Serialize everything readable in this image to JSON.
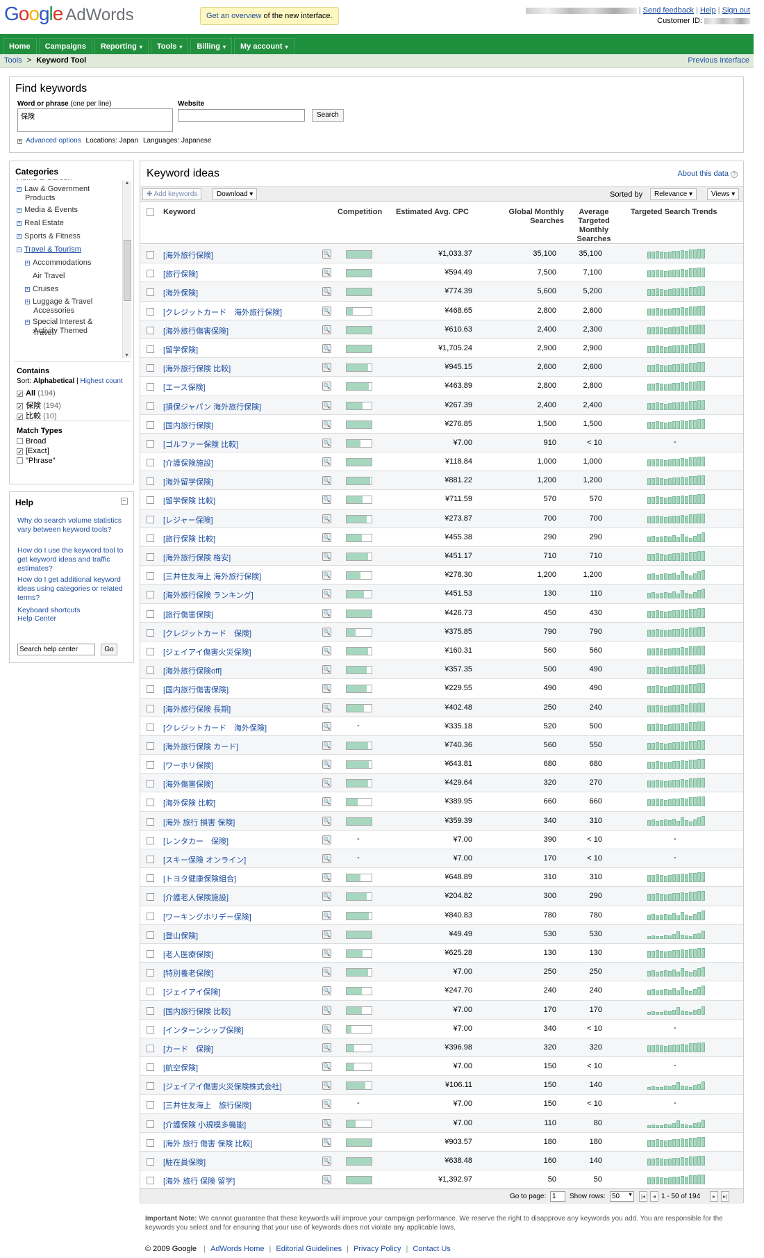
{
  "header": {
    "logo_google": "Google",
    "logo_product": "AdWords",
    "promo_link": "Get an overview",
    "promo_rest": " of the new interface.",
    "send_feedback": "Send feedback",
    "help": "Help",
    "sign_out": "Sign out",
    "customer_id_label": "Customer ID:"
  },
  "nav": {
    "tabs": [
      {
        "label": "Home",
        "caret": ""
      },
      {
        "label": "Campaigns",
        "caret": ""
      },
      {
        "label": "Reporting",
        "caret": "▾"
      },
      {
        "label": "Tools",
        "caret": "▾"
      },
      {
        "label": "Billing",
        "caret": "▾"
      },
      {
        "label": "My account",
        "caret": "▾"
      }
    ]
  },
  "breadcrumb": {
    "parent": "Tools",
    "sep": ">",
    "current": "Keyword Tool",
    "prev_interface": "Previous Interface"
  },
  "find": {
    "title": "Find keywords",
    "word_label": "Word or phrase",
    "word_hint": "(one per line)",
    "word_value": "保険",
    "website_label": "Website",
    "website_value": "",
    "search_button": "Search",
    "advanced": "Advanced options",
    "locations": "Locations: Japan",
    "languages": "Languages: Japanese"
  },
  "categories": {
    "title": "Categories",
    "cut_item": "Home & Garden",
    "items": [
      {
        "label": "Law & Government",
        "label2": "Products",
        "level": 0
      },
      {
        "label": "Media & Events",
        "label2": "",
        "level": 0
      },
      {
        "label": "Real Estate",
        "label2": "",
        "level": 0
      },
      {
        "label": "Sports & Fitness",
        "label2": "",
        "level": 0
      },
      {
        "label": "Travel & Tourism",
        "label2": "",
        "level": 0
      },
      {
        "label": "Accommodations",
        "label2": "",
        "level": 1
      },
      {
        "label": "Air Travel",
        "label2": "",
        "level": 1
      },
      {
        "label": "Cruises",
        "label2": "",
        "level": 1
      },
      {
        "label": "Luggage & Travel",
        "label2": "Accessories",
        "level": 1
      },
      {
        "label": "Special Interest &",
        "label2": "Activity Themed",
        "level": 1
      },
      {
        "label": "Travel",
        "label2": "",
        "level": 1
      }
    ],
    "contains_title": "Contains",
    "sort_label": "Sort:",
    "sort_alpha": "Alphabetical",
    "sort_sep": "|",
    "sort_count": "Highest count",
    "contains": [
      {
        "label": "All",
        "count": "(194)",
        "checked": "✓"
      },
      {
        "label": "保険",
        "count": "(194)",
        "checked": "✓"
      },
      {
        "label": "比較",
        "count": "(10)",
        "checked": "✓"
      }
    ],
    "match_title": "Match Types",
    "match": [
      {
        "label": "Broad",
        "checked": ""
      },
      {
        "label": "[Exact]",
        "checked": "✓"
      },
      {
        "label": "\"Phrase\"",
        "checked": ""
      }
    ]
  },
  "help": {
    "title": "Help",
    "links": [
      "Why do search volume statistics vary between keyword tools?",
      "How do I use the keyword tool to get keyword ideas and traffic estimates?",
      "How do I get additional keyword ideas using categories or related terms?",
      "Keyboard shortcuts",
      "Help Center"
    ],
    "search_value": "Search help center",
    "go": "Go"
  },
  "ideas": {
    "title": "Keyword ideas",
    "about": "About this data",
    "add_keywords": "✚ Add keywords",
    "download": "Download ▾",
    "sorted_by": "Sorted by",
    "relevance": "Relevance ▾",
    "views": "Views ▾",
    "columns": {
      "keyword": "Keyword",
      "competition": "Competition",
      "cpc": "Estimated Avg. CPC",
      "global": "Global Monthly Searches",
      "local": "Average Targeted Monthly Searches",
      "trend": "Targeted Search Trends"
    },
    "rows": [
      {
        "kw": "[海外旅行保険]",
        "comp": 1.0,
        "cpc": "¥1,033.37",
        "glob": "35,100",
        "loc": "35,100",
        "trend": "full"
      },
      {
        "kw": "[旅行保険]",
        "comp": 1.0,
        "cpc": "¥594.49",
        "glob": "7,500",
        "loc": "7,100",
        "trend": "full"
      },
      {
        "kw": "[海外保険]",
        "comp": 1.0,
        "cpc": "¥774.39",
        "glob": "5,600",
        "loc": "5,200",
        "trend": "full"
      },
      {
        "kw": "[クレジットカード　海外旅行保険]",
        "comp": 0.25,
        "cpc": "¥468.65",
        "glob": "2,800",
        "loc": "2,600",
        "trend": "full"
      },
      {
        "kw": "[海外旅行傷害保険]",
        "comp": 1.0,
        "cpc": "¥610.63",
        "glob": "2,400",
        "loc": "2,300",
        "trend": "full"
      },
      {
        "kw": "[留学保険]",
        "comp": 1.0,
        "cpc": "¥1,705.24",
        "glob": "2,900",
        "loc": "2,900",
        "trend": "full"
      },
      {
        "kw": "[海外旅行保険 比較]",
        "comp": 0.85,
        "cpc": "¥945.15",
        "glob": "2,600",
        "loc": "2,600",
        "trend": "full"
      },
      {
        "kw": "[エース保険]",
        "comp": 0.9,
        "cpc": "¥463.89",
        "glob": "2,800",
        "loc": "2,800",
        "trend": "full"
      },
      {
        "kw": "[損保ジャパン 海外旅行保険]",
        "comp": 0.65,
        "cpc": "¥267.39",
        "glob": "2,400",
        "loc": "2,400",
        "trend": "full"
      },
      {
        "kw": "[国内旅行保険]",
        "comp": 1.0,
        "cpc": "¥276.85",
        "glob": "1,500",
        "loc": "1,500",
        "trend": "full"
      },
      {
        "kw": "[ゴルファー保険 比較]",
        "comp": 0.55,
        "cpc": "¥7.00",
        "glob": "910",
        "loc": "< 10",
        "trend": "-"
      },
      {
        "kw": "[介護保険施設]",
        "comp": 1.0,
        "cpc": "¥118.84",
        "glob": "1,000",
        "loc": "1,000",
        "trend": "full"
      },
      {
        "kw": "[海外留学保険]",
        "comp": 0.95,
        "cpc": "¥881.22",
        "glob": "1,200",
        "loc": "1,200",
        "trend": "full"
      },
      {
        "kw": "[留学保険 比較]",
        "comp": 0.65,
        "cpc": "¥711.59",
        "glob": "570",
        "loc": "570",
        "trend": "full"
      },
      {
        "kw": "[レジャー保険]",
        "comp": 0.8,
        "cpc": "¥273.87",
        "glob": "700",
        "loc": "700",
        "trend": "full"
      },
      {
        "kw": "[旅行保険 比較]",
        "comp": 0.6,
        "cpc": "¥455.38",
        "glob": "290",
        "loc": "290",
        "trend": "mid"
      },
      {
        "kw": "[海外旅行保険 格安]",
        "comp": 0.85,
        "cpc": "¥451.17",
        "glob": "710",
        "loc": "710",
        "trend": "full"
      },
      {
        "kw": "[三井住友海上 海外旅行保険]",
        "comp": 0.55,
        "cpc": "¥278.30",
        "glob": "1,200",
        "loc": "1,200",
        "trend": "mid"
      },
      {
        "kw": "[海外旅行保険 ランキング]",
        "comp": 0.7,
        "cpc": "¥451.53",
        "glob": "130",
        "loc": "110",
        "trend": "mid"
      },
      {
        "kw": "[旅行傷害保険]",
        "comp": 1.0,
        "cpc": "¥426.73",
        "glob": "450",
        "loc": "430",
        "trend": "full"
      },
      {
        "kw": "[クレジットカード　保険]",
        "comp": 0.35,
        "cpc": "¥375.85",
        "glob": "790",
        "loc": "790",
        "trend": "full"
      },
      {
        "kw": "[ジェイアイ傷害火災保険]",
        "comp": 0.85,
        "cpc": "¥160.31",
        "glob": "560",
        "loc": "560",
        "trend": "full"
      },
      {
        "kw": "[海外旅行保険off]",
        "comp": 0.8,
        "cpc": "¥357.35",
        "glob": "500",
        "loc": "490",
        "trend": "full"
      },
      {
        "kw": "[国内旅行傷害保険]",
        "comp": 0.8,
        "cpc": "¥229.55",
        "glob": "490",
        "loc": "490",
        "trend": "full"
      },
      {
        "kw": "[海外旅行保険 長期]",
        "comp": 0.7,
        "cpc": "¥402.48",
        "glob": "250",
        "loc": "240",
        "trend": "full"
      },
      {
        "kw": "[クレジットカード　海外保険]",
        "comp": -1,
        "cpc": "¥335.18",
        "glob": "520",
        "loc": "500",
        "trend": "full"
      },
      {
        "kw": "[海外旅行保険 カード]",
        "comp": 0.85,
        "cpc": "¥740.36",
        "glob": "560",
        "loc": "550",
        "trend": "full"
      },
      {
        "kw": "[ワーホリ保険]",
        "comp": 0.9,
        "cpc": "¥643.81",
        "glob": "680",
        "loc": "680",
        "trend": "full"
      },
      {
        "kw": "[海外傷害保険]",
        "comp": 0.85,
        "cpc": "¥429.64",
        "glob": "320",
        "loc": "270",
        "trend": "full"
      },
      {
        "kw": "[海外保険 比較]",
        "comp": 0.45,
        "cpc": "¥389.95",
        "glob": "660",
        "loc": "660",
        "trend": "full"
      },
      {
        "kw": "[海外 旅行 損害 保険]",
        "comp": 1.0,
        "cpc": "¥359.39",
        "glob": "340",
        "loc": "310",
        "trend": "mid"
      },
      {
        "kw": "[レンタカー　保険]",
        "comp": -1,
        "cpc": "¥7.00",
        "glob": "390",
        "loc": "< 10",
        "trend": "-"
      },
      {
        "kw": "[スキー保険 オンライン]",
        "comp": -1,
        "cpc": "¥7.00",
        "glob": "170",
        "loc": "< 10",
        "trend": "-"
      },
      {
        "kw": "[トヨタ健康保険組合]",
        "comp": 0.55,
        "cpc": "¥648.89",
        "glob": "310",
        "loc": "310",
        "trend": "full"
      },
      {
        "kw": "[介護老人保険施設]",
        "comp": 0.8,
        "cpc": "¥204.82",
        "glob": "300",
        "loc": "290",
        "trend": "full"
      },
      {
        "kw": "[ワーキングホリデー保険]",
        "comp": 0.9,
        "cpc": "¥840.83",
        "glob": "780",
        "loc": "780",
        "trend": "mid"
      },
      {
        "kw": "[登山保険]",
        "comp": 1.0,
        "cpc": "¥49.49",
        "glob": "530",
        "loc": "530",
        "trend": "low"
      },
      {
        "kw": "[老人医療保険]",
        "comp": 0.65,
        "cpc": "¥625.28",
        "glob": "130",
        "loc": "130",
        "trend": "full"
      },
      {
        "kw": "[特別養老保険]",
        "comp": 0.85,
        "cpc": "¥7.00",
        "glob": "250",
        "loc": "250",
        "trend": "mid"
      },
      {
        "kw": "[ジェイアイ保険]",
        "comp": 0.6,
        "cpc": "¥247.70",
        "glob": "240",
        "loc": "240",
        "trend": "mid"
      },
      {
        "kw": "[国内旅行保険 比較]",
        "comp": 0.6,
        "cpc": "¥7.00",
        "glob": "170",
        "loc": "170",
        "trend": "low"
      },
      {
        "kw": "[インターンシップ保険]",
        "comp": 0.2,
        "cpc": "¥7.00",
        "glob": "340",
        "loc": "< 10",
        "trend": "-"
      },
      {
        "kw": "[カード　保険]",
        "comp": 0.3,
        "cpc": "¥396.98",
        "glob": "320",
        "loc": "320",
        "trend": "full"
      },
      {
        "kw": "[航空保険]",
        "comp": 0.3,
        "cpc": "¥7.00",
        "glob": "150",
        "loc": "< 10",
        "trend": "-"
      },
      {
        "kw": "[ジェイアイ傷害火災保険株式会社]",
        "comp": 0.75,
        "cpc": "¥106.11",
        "glob": "150",
        "loc": "140",
        "trend": "low"
      },
      {
        "kw": "[三井住友海上　旅行保険]",
        "comp": -1,
        "cpc": "¥7.00",
        "glob": "150",
        "loc": "< 10",
        "trend": "-"
      },
      {
        "kw": "[介護保険 小規模多機能]",
        "comp": 0.35,
        "cpc": "¥7.00",
        "glob": "110",
        "loc": "80",
        "trend": "low"
      },
      {
        "kw": "[海外 旅行 傷害 保険 比較]",
        "comp": 1.0,
        "cpc": "¥903.57",
        "glob": "180",
        "loc": "180",
        "trend": "full"
      },
      {
        "kw": "[駐在員保険]",
        "comp": 1.0,
        "cpc": "¥638.48",
        "glob": "160",
        "loc": "140",
        "trend": "full"
      },
      {
        "kw": "[海外 旅行 保険 留学]",
        "comp": 1.0,
        "cpc": "¥1,392.97",
        "glob": "50",
        "loc": "50",
        "trend": "full"
      }
    ],
    "pager": {
      "goto_label": "Go to page:",
      "goto_value": "1",
      "show_rows": "Show rows:",
      "rows_value": "50",
      "range": "1 - 50 of 194"
    }
  },
  "note": {
    "label": "Important Note:",
    "text": " We cannot guarantee that these keywords will improve your campaign performance. We reserve the right to disapprove any keywords you add. You are responsible for the keywords you select and for ensuring that your use of keywords does not violate any applicable laws."
  },
  "footer": {
    "copyright": "© 2009 Google",
    "links": [
      "AdWords Home",
      "Editorial Guidelines",
      "Privacy Policy",
      "Contact Us"
    ]
  },
  "colors": {
    "nav_green": "#1e8f3c",
    "bar_green": "#a7d7be",
    "link_blue": "#1d4ea0"
  }
}
